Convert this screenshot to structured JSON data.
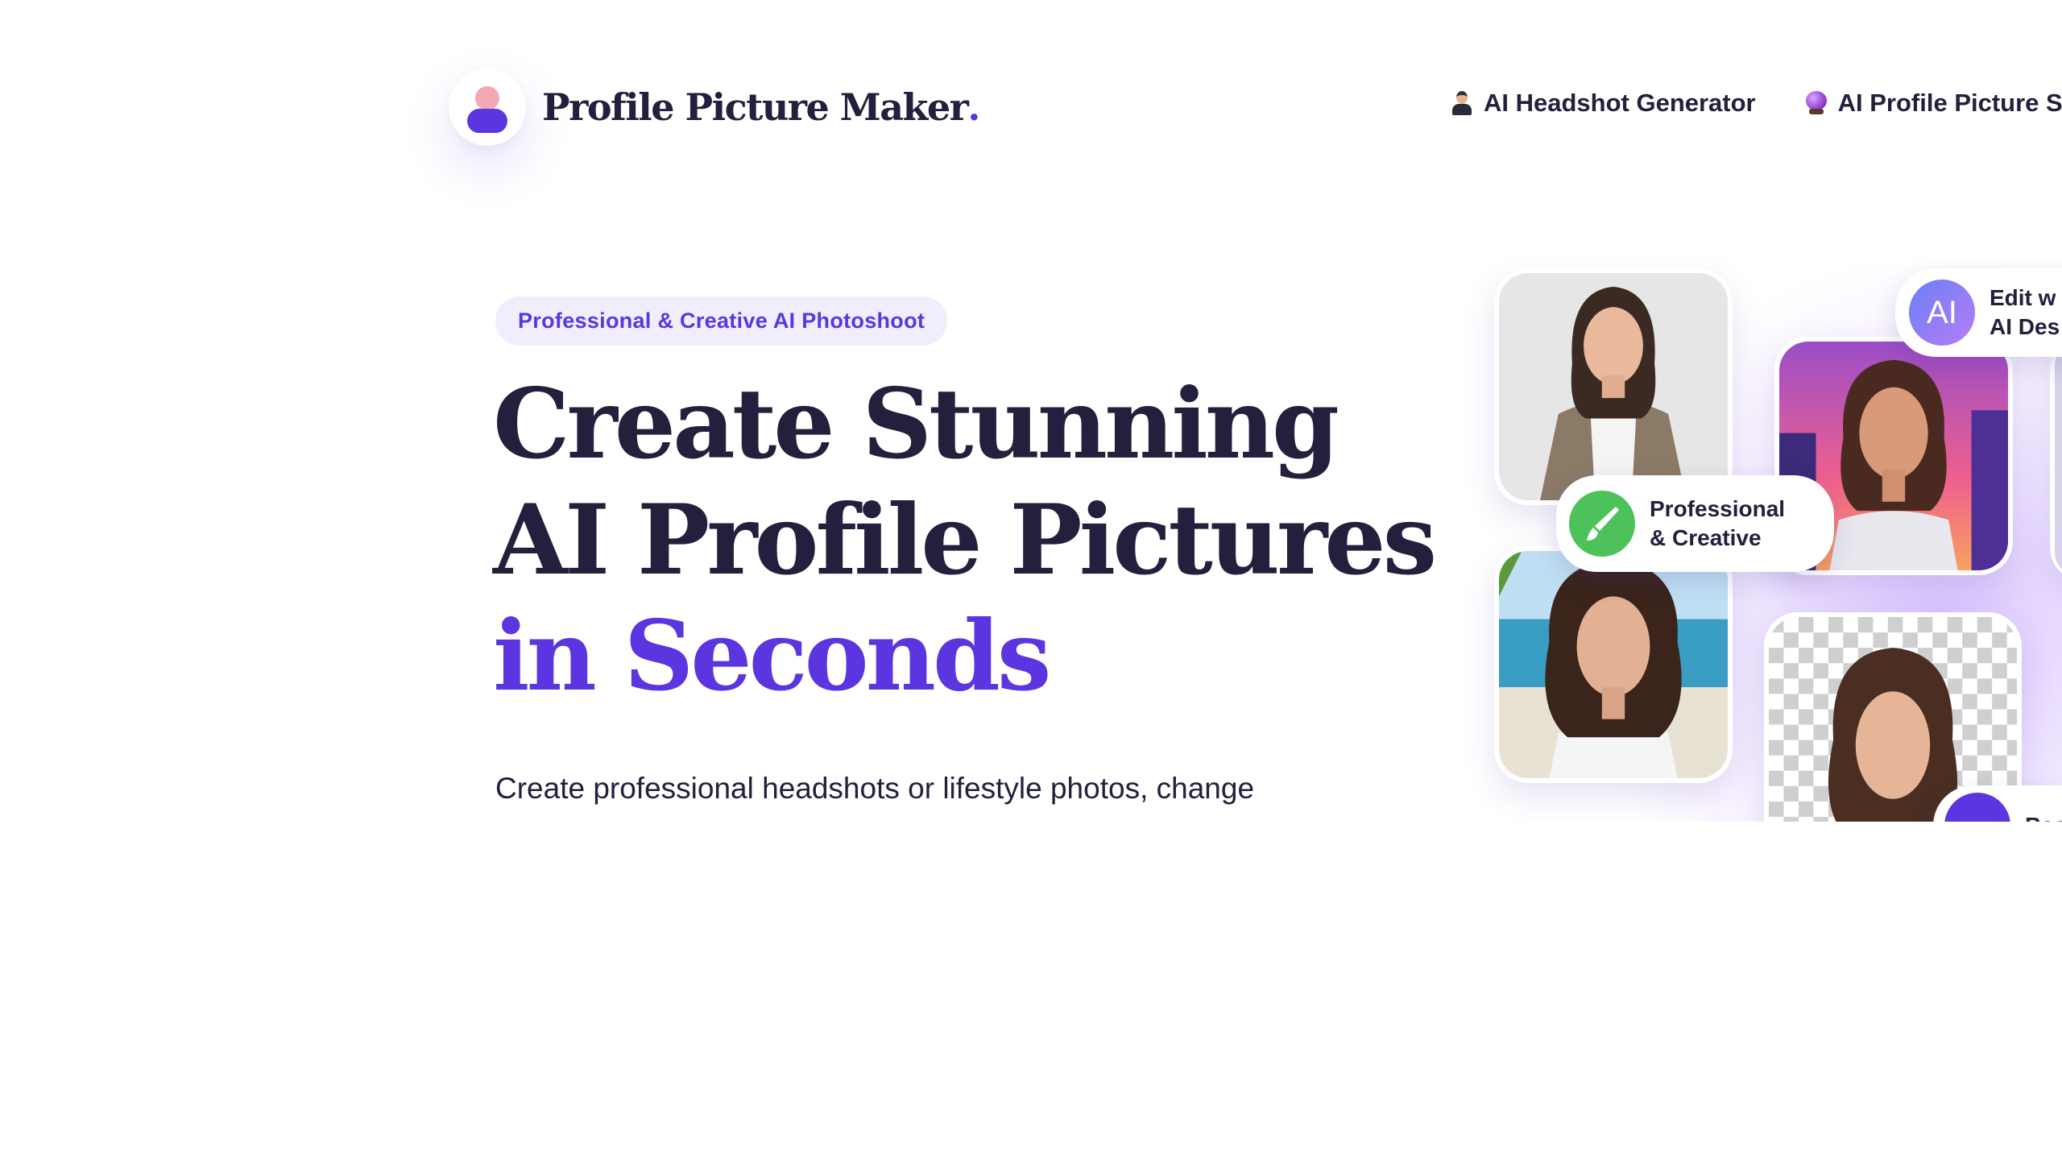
{
  "header": {
    "logo_text": "Profile Picture Maker",
    "logo_dot": ".",
    "nav": [
      {
        "icon": "person-in-suit-icon",
        "label": "AI Headshot Generator"
      },
      {
        "icon": "crystal-ball-icon",
        "label": "AI Profile Picture Sty"
      }
    ]
  },
  "hero": {
    "pill": "Professional & Creative AI Photoshoot",
    "headline_part1": "Create Stunning AI Profile Pictures ",
    "headline_accent": "in Seconds",
    "subtext": "Create professional headshots or lifestyle photos, change"
  },
  "collage": {
    "badge_professional": "Professional\n& Creative",
    "badge_ai_icon": "AI",
    "badge_ai_label": "Edit w\nAI Des",
    "badge_bg_label": "Bac"
  },
  "colors": {
    "accent": "#5b36e0",
    "text": "#22203c",
    "pill_bg": "#f0eefc",
    "green": "#4ec25a"
  }
}
